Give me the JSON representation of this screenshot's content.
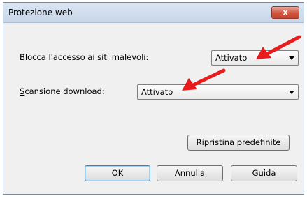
{
  "window": {
    "title": "Protezione web",
    "close_glyph": "x",
    "close_icon": "close-icon"
  },
  "fields": [
    {
      "label_access": "B",
      "label_rest": "locca l'accesso ai siti malevoli:",
      "value": "Attivato"
    },
    {
      "label_access": "S",
      "label_rest": "cansione download:",
      "value": "Attivato"
    }
  ],
  "buttons": {
    "restore_defaults": "Ripristina predefinite",
    "ok": "OK",
    "cancel": "Annulla",
    "help": "Guida"
  },
  "annotations": {
    "arrow_color": "#e81c1c",
    "arrow_icon": "arrow-icon"
  }
}
